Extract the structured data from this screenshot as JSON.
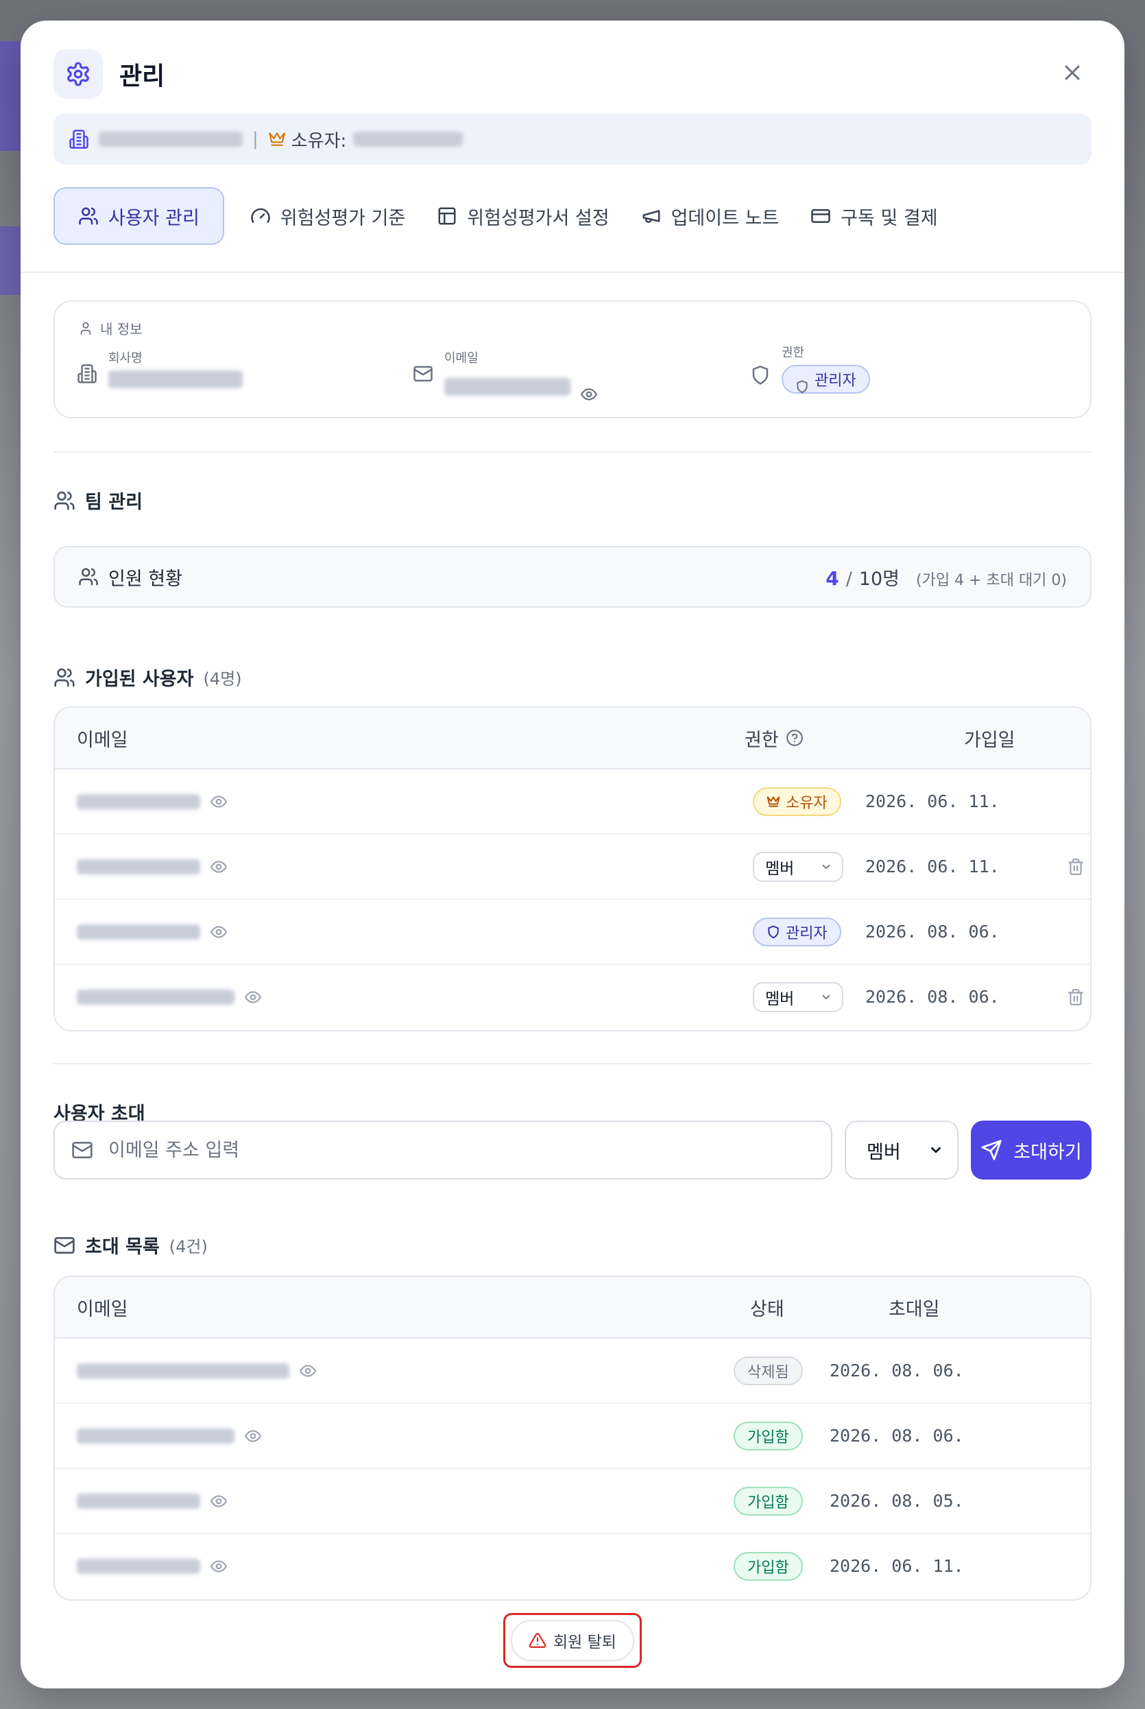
{
  "modal": {
    "title": "관리",
    "owner_label": "소유자:",
    "separator": "|"
  },
  "tabs": [
    {
      "label": "사용자 관리",
      "icon": "users-icon",
      "active": true
    },
    {
      "label": "위험성평가 기준",
      "icon": "gauge-icon",
      "active": false
    },
    {
      "label": "위험성평가서 설정",
      "icon": "table-icon",
      "active": false
    },
    {
      "label": "업데이트 노트",
      "icon": "megaphone-icon",
      "active": false
    },
    {
      "label": "구독 및 결제",
      "icon": "credit-card-icon",
      "active": false
    }
  ],
  "my_info": {
    "section_label": "내 정보",
    "company_label": "회사명",
    "email_label": "이메일",
    "role_label": "권한",
    "role_value": "관리자"
  },
  "team": {
    "title": "팀 관리",
    "headcount_label": "인원 현황",
    "current": "4",
    "slash": "/",
    "max": "10명",
    "detail": "(가입 4 + 초대 대기 0)"
  },
  "members": {
    "title": "가입된 사용자",
    "count": "(4명)",
    "columns": {
      "email": "이메일",
      "role": "권한",
      "joined": "가입일"
    },
    "rows": [
      {
        "role_type": "badge-owner",
        "role": "소유자",
        "date": "2026. 06. 11.",
        "deletable": false
      },
      {
        "role_type": "select",
        "role": "멤버",
        "date": "2026. 06. 11.",
        "deletable": true
      },
      {
        "role_type": "badge-admin",
        "role": "관리자",
        "date": "2026. 08. 06.",
        "deletable": false
      },
      {
        "role_type": "select",
        "role": "멤버",
        "date": "2026. 08. 06.",
        "deletable": true
      }
    ]
  },
  "invite": {
    "title": "사용자 초대",
    "placeholder": "이메일 주소 입력",
    "role_default": "멤버",
    "button_label": "초대하기"
  },
  "invitations": {
    "title": "초대 목록",
    "count": "(4건)",
    "columns": {
      "email": "이메일",
      "status": "상태",
      "invited": "초대일"
    },
    "rows": [
      {
        "status": "삭제됨",
        "status_type": "deleted",
        "date": "2026. 08. 06."
      },
      {
        "status": "가입함",
        "status_type": "joined",
        "date": "2026. 08. 06."
      },
      {
        "status": "가입함",
        "status_type": "joined",
        "date": "2026. 08. 05."
      },
      {
        "status": "가입함",
        "status_type": "joined",
        "date": "2026. 06. 11."
      }
    ]
  },
  "withdraw": {
    "label": "회원 탈퇴"
  },
  "colors": {
    "accent": "#4f46e5",
    "danger": "#dc2626",
    "owner": "#b45309",
    "joined": "#047857"
  }
}
